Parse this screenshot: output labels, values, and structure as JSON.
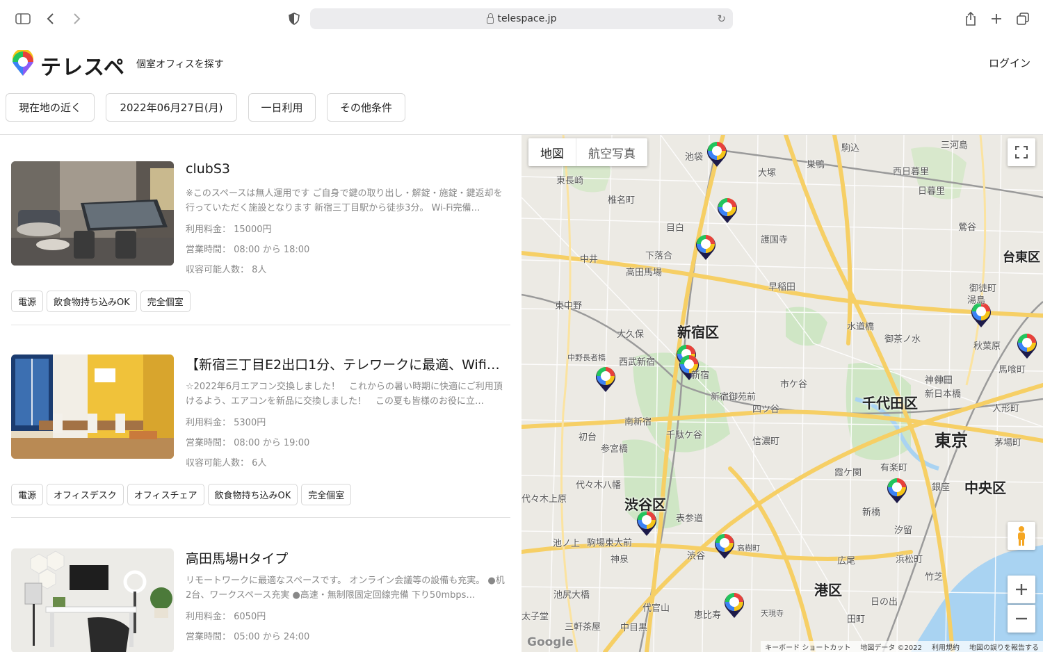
{
  "browser": {
    "url": "telespace.jp"
  },
  "header": {
    "logo_text": "テレスペ",
    "nav_search": "個室オフィスを探す",
    "login": "ログイン"
  },
  "filters": [
    {
      "label": "現在地の近く"
    },
    {
      "label": "2022年06月27日(月)"
    },
    {
      "label": "一日利用"
    },
    {
      "label": "その他条件"
    }
  ],
  "listings": [
    {
      "title": "clubS3",
      "description": "※このスペースは無人運用です ご自身で鍵の取り出し・解錠・施錠・鍵返却を行っていただく施設となります 新宿三丁目駅から徒歩3分。 Wi-Fi完備…",
      "price": "利用料金： 15000円",
      "hours": "営業時間： 08:00 から 18:00",
      "capacity": "収容可能人数： 8人",
      "tags": [
        "電源",
        "飲食物持ち込みOK",
        "完全個室"
      ]
    },
    {
      "title": "【新宿三丁目E2出口1分、テレワークに最適、Wifi…",
      "description": "☆2022年6月エアコン交換しました！　これからの暑い時期に快適にご利用頂けるよう、エアコンを新品に交換しました！　この夏も皆様のお役に立…",
      "price": "利用料金： 5300円",
      "hours": "営業時間： 08:00 から 19:00",
      "capacity": "収容可能人数： 6人",
      "tags": [
        "電源",
        "オフィスデスク",
        "オフィスチェア",
        "飲食物持ち込みOK",
        "完全個室"
      ]
    },
    {
      "title": "高田馬場Hタイプ",
      "description": "リモートワークに最適なスペースです。 オンライン会議等の設備も充実。 ●机2台、ワークスペース充実 ●高速・無制限固定回線完備 下り50mbps…",
      "price": "利用料金： 6050円",
      "hours": "営業時間： 05:00 から 24:00",
      "capacity": "",
      "tags": []
    }
  ],
  "map": {
    "type_map": "地図",
    "type_satellite": "航空写真",
    "wards": [
      "新宿区",
      "千代田区",
      "東京",
      "中央区",
      "渋谷区",
      "港区",
      "台東区"
    ],
    "places": [
      "池袋",
      "大塚",
      "巣鴨",
      "駒込",
      "三河島",
      "西日暮里",
      "日暮里",
      "東長崎",
      "椎名町",
      "目白",
      "護国寺",
      "下落合",
      "中井",
      "高田馬場",
      "早稲田",
      "鶯谷",
      "御徒町",
      "湯島",
      "東中野",
      "大久保",
      "西武新宿",
      "中野長者橋",
      "新宿",
      "新宿御苑前",
      "四ツ谷",
      "市ケ谷",
      "神保町",
      "新日本橋",
      "秋葉原",
      "水道橋",
      "御茶ノ水",
      "南新宿",
      "千駄ケ谷",
      "信濃町",
      "初台",
      "参宮橋",
      "代々木八幡",
      "代々木上原",
      "表参道",
      "渋谷",
      "池ノ上",
      "駒場東大前",
      "神泉",
      "広尾",
      "池尻大橋",
      "代官山",
      "恵比寿",
      "中目黒",
      "三軒茶屋",
      "太子堂",
      "有楽町",
      "銀座",
      "新橋",
      "汐留",
      "浜松町",
      "竹芝",
      "日の出",
      "田町",
      "天現寺",
      "高樹町",
      "霞ケ関",
      "人形町",
      "茅場町",
      "馬喰町",
      "神田"
    ],
    "footer": [
      "キーボード ショートカット",
      "地図データ ©2022",
      "利用規約",
      "地図の誤りを報告する"
    ],
    "google": "Google"
  },
  "colors": {
    "brand_pin": [
      "#f5c518",
      "#e8413c",
      "#3b82f6",
      "#22c55e",
      "#8b5cf6"
    ],
    "map_bg": "#eceae4",
    "road_major": "#f6cf65",
    "park": "#cfe6c5",
    "water": "#a9d3f2"
  }
}
